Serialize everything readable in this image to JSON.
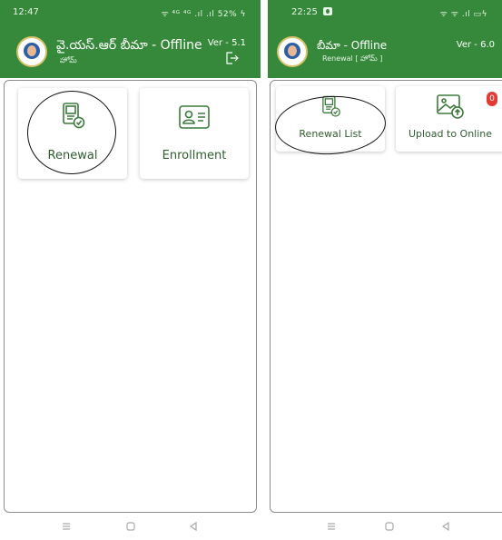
{
  "left_screen": {
    "status": {
      "time": "12:47",
      "indicators": "ᯤ ⁴ᴳ ⁴ᴳ .ıl .ıl 52% ϟ"
    },
    "app_bar": {
      "title": "వై.యస్.ఆర్ బీమా - Offline",
      "subtitle": "హోమ్",
      "version": "Ver - 5.1"
    },
    "cards": {
      "renewal": "Renewal",
      "enrollment": "Enrollment"
    }
  },
  "right_screen": {
    "status": {
      "time": "22:25",
      "indicators": "ᯤ ᯤ .ıl ▭ϟ"
    },
    "app_bar": {
      "title": "బీమా - Offline",
      "subtitle": "Renewal [ హోమ్ ]",
      "version": "Ver - 6.0"
    },
    "cards": {
      "renewal_list": "Renewal List",
      "upload": "Upload to Online",
      "upload_badge": "0"
    }
  },
  "colors": {
    "brand_green": "#36893a",
    "label_green": "#2f5d2f",
    "badge_red": "#e53935",
    "icon_green": "#3c7a3c"
  },
  "icons": [
    "logo-emblem",
    "renewal-document-icon",
    "id-card-icon",
    "image-upload-icon",
    "logout-icon",
    "menu-nav-icon",
    "home-nav-icon",
    "back-nav-icon"
  ]
}
